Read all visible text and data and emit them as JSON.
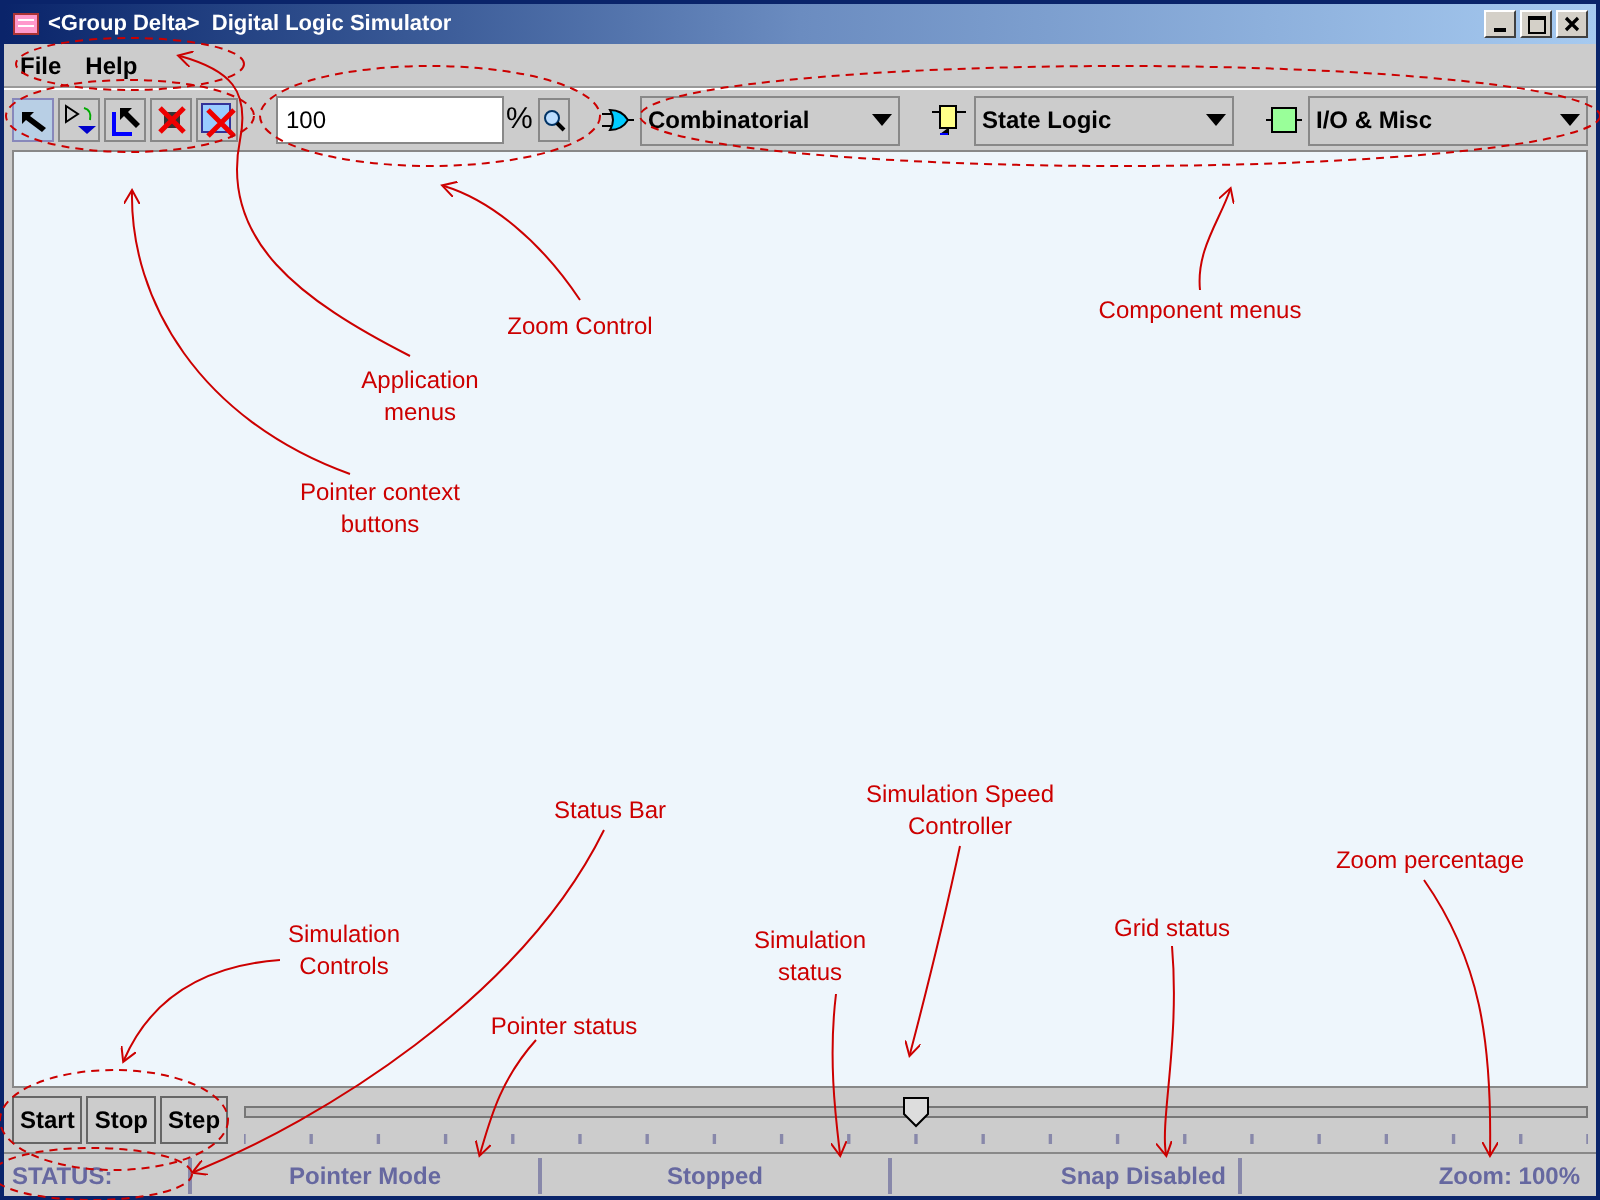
{
  "window": {
    "title": "<Group Delta>  Digital Logic Simulator"
  },
  "menus": [
    "File",
    "Help"
  ],
  "pointer_buttons": [
    {
      "kind": "select",
      "selected": true
    },
    {
      "kind": "wire",
      "selected": false
    },
    {
      "kind": "move",
      "selected": false
    },
    {
      "kind": "delete",
      "selected": false
    },
    {
      "kind": "clear",
      "selected": false
    }
  ],
  "zoom": {
    "value": "100",
    "unit": "%"
  },
  "component_menus": [
    {
      "kind": "gate",
      "label": "Combinatorial"
    },
    {
      "kind": "flipflop",
      "label": "State Logic"
    },
    {
      "kind": "io",
      "label": "I/O & Misc"
    }
  ],
  "sim_buttons": [
    "Start",
    "Stop",
    "Step"
  ],
  "speed_slider": {
    "level": 0.5
  },
  "status_bar": [
    "STATUS:",
    "Pointer Mode",
    "Stopped",
    "Snap Disabled",
    "Zoom: 100%"
  ],
  "annotations": [
    "Zoom Control",
    "Component menus",
    "Application\nmenus",
    "Pointer context\nbuttons",
    "Status Bar",
    "Simulation Speed\nController",
    "Zoom percentage",
    "Simulation\nControls",
    "Simulation\nstatus",
    "Grid status",
    "Pointer status"
  ]
}
